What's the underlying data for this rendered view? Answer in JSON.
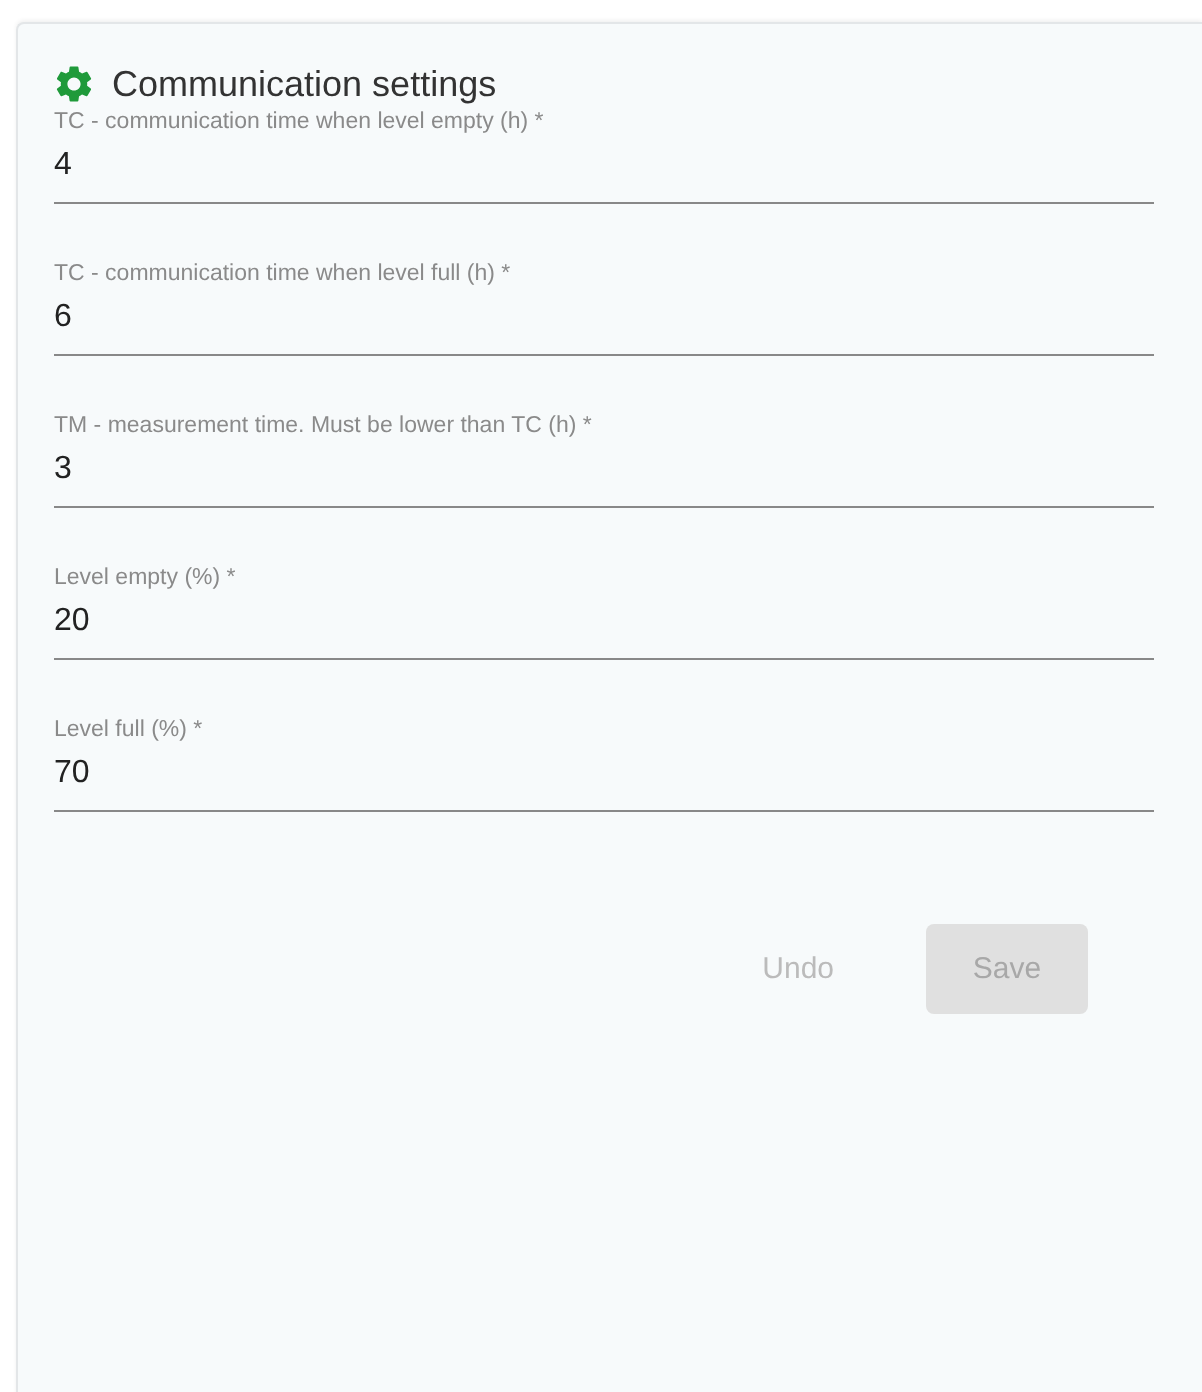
{
  "card": {
    "title": "Communication settings",
    "fields": [
      {
        "label": "TC - communication time when level empty (h) *",
        "value": "4"
      },
      {
        "label": "TC - communication time when level full (h) *",
        "value": "6"
      },
      {
        "label": "TM - measurement time. Must be lower than TC (h) *",
        "value": "3"
      },
      {
        "label": "Level empty (%) *",
        "value": "20"
      },
      {
        "label": "Level full (%) *",
        "value": "70"
      }
    ],
    "buttons": [
      {
        "label": "Undo",
        "kind": "text",
        "disabled": true
      },
      {
        "label": "Save",
        "kind": "filled",
        "disabled": true
      }
    ]
  }
}
